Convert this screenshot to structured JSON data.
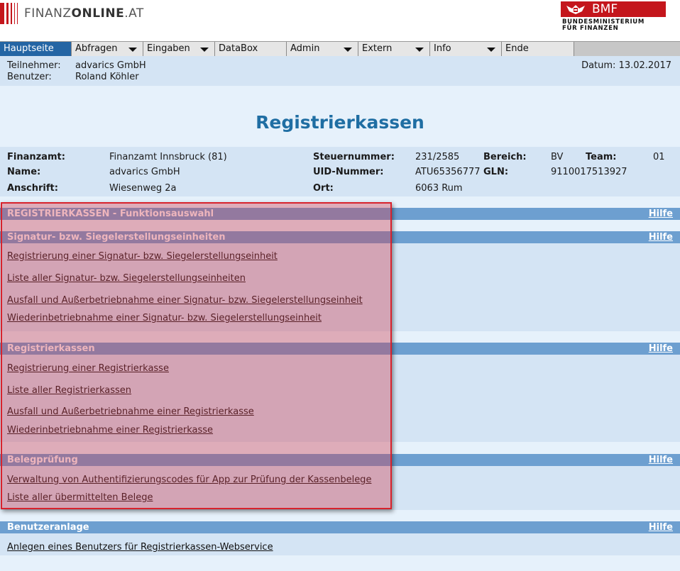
{
  "header": {
    "logo_text_light": "FINANZ",
    "logo_text_bold": "ONLINE",
    "logo_text_suffix": ".AT",
    "bmf_short": "BMF",
    "bmf_line1": "BUNDESMINISTERIUM",
    "bmf_line2": "FÜR FINANZEN"
  },
  "nav": {
    "items": [
      {
        "label": "Hauptseite",
        "has_dropdown": false,
        "active": true
      },
      {
        "label": "Abfragen",
        "has_dropdown": true
      },
      {
        "label": "Eingaben",
        "has_dropdown": true
      },
      {
        "label": "DataBox",
        "has_dropdown": false
      },
      {
        "label": "Admin",
        "has_dropdown": true
      },
      {
        "label": "Extern",
        "has_dropdown": true
      },
      {
        "label": "Info",
        "has_dropdown": true
      },
      {
        "label": "Ende",
        "has_dropdown": false
      }
    ]
  },
  "user": {
    "participant_label": "Teilnehmer:",
    "participant_value": "advarics GmbH",
    "user_label": "Benutzer:",
    "user_value": "Roland Köhler",
    "date_text": "Datum: 13.02.2017"
  },
  "page_title": "Registrierkassen",
  "tax_info": {
    "finanzamt_label": "Finanzamt:",
    "finanzamt_value": "Finanzamt Innsbruck (81)",
    "name_label": "Name:",
    "name_value": "advarics GmbH",
    "address_label": "Anschrift:",
    "address_value": "Wiesenweg 2a",
    "tax_number_label": "Steuernummer:",
    "tax_number_value": "231/2585",
    "uid_label": "UID-Nummer:",
    "uid_value": "ATU65356777",
    "city_label": "Ort:",
    "city_value": "6063 Rum",
    "area_label": "Bereich:",
    "area_value": "BV",
    "gln_label": "GLN:",
    "gln_value": "9110017513927",
    "team_label": "Team:",
    "team_value": "01"
  },
  "sections": {
    "main": {
      "title": "REGISTRIERKASSEN - Funktionsauswahl",
      "help": "Hilfe"
    },
    "signature": {
      "title": "Signatur- bzw. Siegelerstellungseinheiten",
      "help": "Hilfe",
      "links": [
        "Registrierung einer Signatur- bzw. Siegelerstellungseinheit",
        "Liste aller Signatur- bzw. Siegelerstellungseinheiten",
        "Ausfall und Außerbetriebnahme einer Signatur- bzw. Siegelerstellungseinheit",
        "Wiederinbetriebnahme einer Signatur- bzw. Siegelerstellungseinheit"
      ]
    },
    "registers": {
      "title": "Registrierkassen",
      "help": "Hilfe",
      "links": [
        "Registrierung einer Registrierkasse",
        "Liste aller Registrierkassen",
        "Ausfall und Außerbetriebnahme einer Registrierkasse",
        "Wiederinbetriebnahme einer Registrierkasse"
      ]
    },
    "receipts": {
      "title": "Belegprüfung",
      "help": "Hilfe",
      "links": [
        "Verwaltung von Authentifizierungscodes für App zur Prüfung der Kassenbelege",
        "Liste aller übermittelten Belege"
      ]
    },
    "users": {
      "title": "Benutzeranlage",
      "help": "Hilfe",
      "links": [
        "Anlegen eines Benutzers für Registrierkassen-Webservice"
      ]
    }
  },
  "colors": {
    "nav_active": "#2465a4",
    "section_bar": "#6d9fd0",
    "highlight_border": "#d8222c",
    "title": "#1f6ea3"
  }
}
